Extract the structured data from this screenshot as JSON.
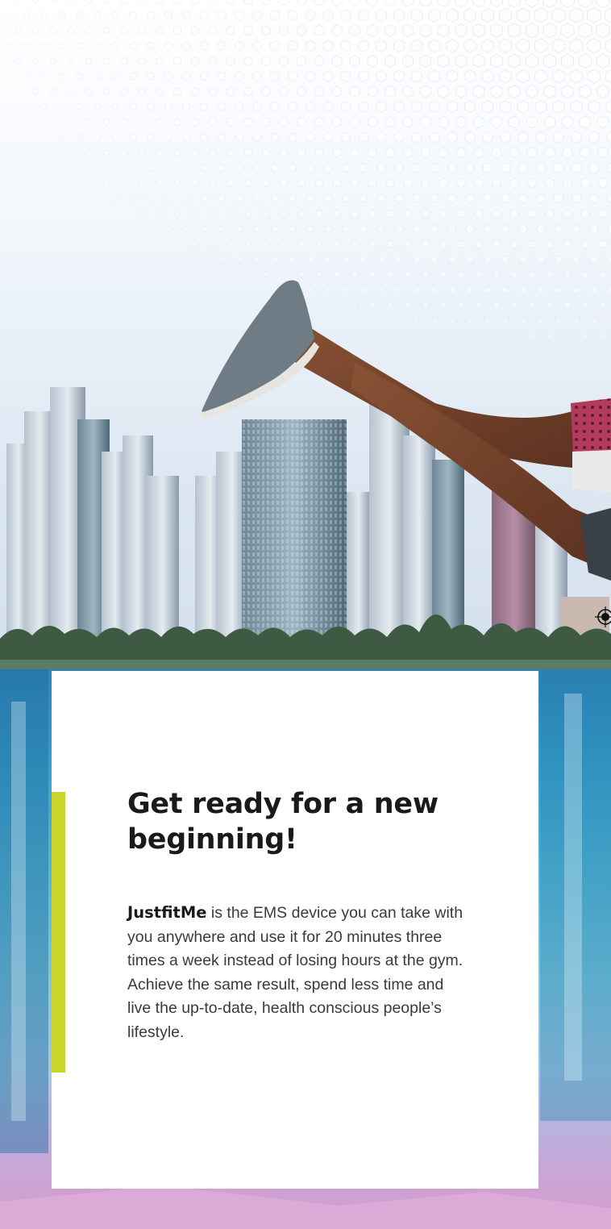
{
  "card": {
    "headline": "Get ready for a new beginning!",
    "brand": "JustfitMe",
    "body": " is the EMS device you can take with you anywhere and use it for 20 minutes three times a week instead of losing hours at the gym. Achieve the same result, spend less time and live the up-to-date, health conscious people’s lifestyle."
  },
  "colors": {
    "accent": "#c9d52a",
    "text_dark": "#1a1a1a",
    "text_body": "#3a3a3a",
    "water": "#3aa0cc"
  },
  "icons": {
    "registration_mark": "registration-mark-icon"
  }
}
